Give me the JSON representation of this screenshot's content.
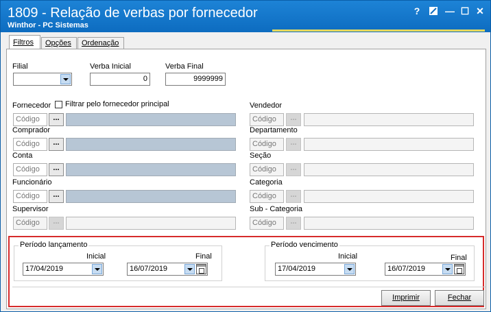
{
  "window": {
    "title": "1809 - Relação de verbas por fornecedor",
    "subtitle": "Winthor - PC Sistemas",
    "help_label": "?",
    "minimize_label": "—",
    "maximize_label": "☐",
    "close_label": "✕"
  },
  "tabs": [
    {
      "label": "Filtros"
    },
    {
      "label": "Opções"
    },
    {
      "label": "Ordenação"
    }
  ],
  "filters": {
    "filial": {
      "label": "Filial",
      "value": ""
    },
    "verba_inicial": {
      "label": "Verba Inicial",
      "value": "0"
    },
    "verba_final": {
      "label": "Verba Final",
      "value": "9999999"
    },
    "fornecedor": {
      "label": "Fornecedor",
      "checkbox_label": "Filtrar pelo fornecedor principal",
      "placeholder": "Código",
      "dots": "..."
    },
    "comprador": {
      "label": "Comprador",
      "placeholder": "Código",
      "dots": "..."
    },
    "conta": {
      "label": "Conta",
      "placeholder": "Código",
      "dots": "..."
    },
    "funcionario": {
      "label": "Funcionário",
      "placeholder": "Código",
      "dots": "..."
    },
    "supervisor": {
      "label": "Supervisor",
      "placeholder": "Código",
      "dots": "..."
    },
    "vendedor": {
      "label": "Vendedor",
      "placeholder": "Código",
      "dots": "..."
    },
    "departamento": {
      "label": "Departamento",
      "placeholder": "Código",
      "dots": "..."
    },
    "secao": {
      "label": "Seção",
      "placeholder": "Código",
      "dots": "..."
    },
    "categoria": {
      "label": "Categoria",
      "placeholder": "Código",
      "dots": "..."
    },
    "subcategoria": {
      "label": "Sub - Categoria",
      "placeholder": "Código",
      "dots": "..."
    }
  },
  "periodo_lancamento": {
    "title": "Período lançamento",
    "inicial_label": "Inicial",
    "final_label": "Final",
    "inicial": "17/04/2019",
    "final": "16/07/2019"
  },
  "periodo_vencimento": {
    "title": "Período vencimento",
    "inicial_label": "Inicial",
    "final_label": "Final",
    "inicial": "17/04/2019",
    "final": "16/07/2019"
  },
  "buttons": {
    "imprimir": "Imprimir",
    "fechar": "Fechar"
  },
  "colors": {
    "titlebar": "#1d83d6",
    "highlight": "#d62b2b",
    "disabled_field": "#b7c6d5"
  }
}
